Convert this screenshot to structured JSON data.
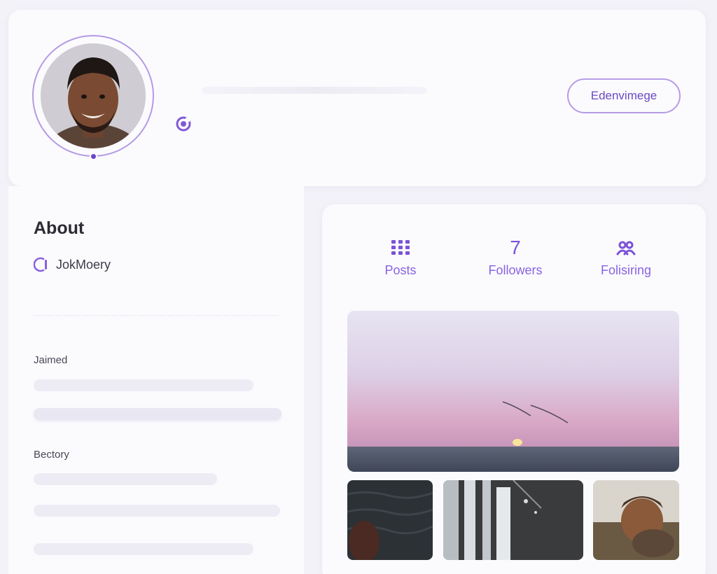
{
  "header": {
    "edit_button_label": "Edenvimege"
  },
  "about": {
    "title": "About",
    "username": "JokMoery",
    "joined_label": "Jaimed",
    "bio_label": "Bectory"
  },
  "stats": {
    "posts": {
      "label": "Posts",
      "icon": "grid-icon"
    },
    "followers": {
      "value": "7",
      "label": "Followers"
    },
    "following": {
      "label": "Folisiring",
      "icon": "people-icon"
    }
  },
  "colors": {
    "accent": "#7b52d6",
    "accent_light": "#b79be6",
    "background": "#f3f2f8",
    "card": "#fbfbfe"
  }
}
